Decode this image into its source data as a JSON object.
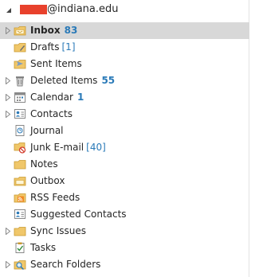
{
  "account": {
    "email_suffix": "@indiana.edu"
  },
  "folders": [
    {
      "name": "Inbox",
      "count": "83"
    },
    {
      "name": "Drafts",
      "count": "[1]"
    },
    {
      "name": "Sent Items"
    },
    {
      "name": "Deleted Items",
      "count": "55"
    },
    {
      "name": "Calendar",
      "count": "1"
    },
    {
      "name": "Contacts"
    },
    {
      "name": "Journal"
    },
    {
      "name": "Junk E-mail",
      "count": "[40]"
    },
    {
      "name": "Notes"
    },
    {
      "name": "Outbox"
    },
    {
      "name": "RSS Feeds"
    },
    {
      "name": "Suggested Contacts"
    },
    {
      "name": "Sync Issues"
    },
    {
      "name": "Tasks"
    },
    {
      "name": "Search Folders"
    }
  ],
  "colors": {
    "count_blue": "#2a7ab8",
    "selected_bg": "#d8d8d8",
    "redaction": "#e8412c"
  }
}
